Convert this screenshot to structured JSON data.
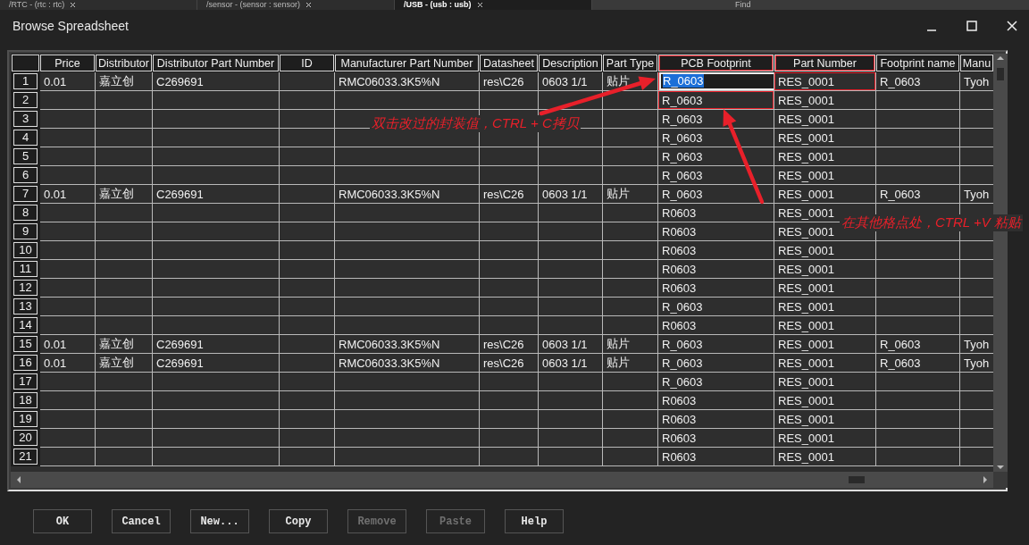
{
  "tabs": [
    {
      "label": "/RTC - (rtc : rtc)",
      "selected": false
    },
    {
      "label": "/sensor - (sensor : sensor)",
      "selected": false
    },
    {
      "label": "/USB - (usb : usb)",
      "selected": true
    },
    {
      "label": "Find",
      "selected": false
    }
  ],
  "window": {
    "title": "Browse Spreadsheet"
  },
  "columns": [
    {
      "label": "Price",
      "marked": false
    },
    {
      "label": "Distributor",
      "marked": false
    },
    {
      "label": "Distributor Part Number",
      "marked": false
    },
    {
      "label": "ID",
      "marked": false
    },
    {
      "label": "Manufacturer Part Number",
      "marked": false
    },
    {
      "label": "Datasheet",
      "marked": false
    },
    {
      "label": "Description",
      "marked": false
    },
    {
      "label": "Part Type",
      "marked": false
    },
    {
      "label": "PCB Footprint",
      "marked": true
    },
    {
      "label": "Part Number",
      "marked": true
    },
    {
      "label": "Footprint name",
      "marked": false
    },
    {
      "label": "Manu",
      "marked": false
    }
  ],
  "rows": [
    {
      "number": "1",
      "editing": true,
      "cells": [
        {
          "text": "0.01",
          "marked": false
        },
        {
          "text": "嘉立创",
          "marked": false
        },
        {
          "text": "C269691",
          "marked": false
        },
        null,
        {
          "text": "RMC06033.3K5%N",
          "marked": false
        },
        {
          "text": "res\\C26",
          "marked": false
        },
        {
          "text": "0603 1/1",
          "marked": false
        },
        {
          "text": "贴片",
          "marked": false
        },
        {
          "text": "R_0603",
          "marked": true
        },
        {
          "text": "RES_0001",
          "marked": true
        },
        {
          "text": "R_0603",
          "marked": false
        },
        {
          "text": "Tyoh",
          "marked": false
        }
      ]
    },
    {
      "number": "2",
      "editing": false,
      "cells": [
        null,
        null,
        null,
        null,
        null,
        null,
        null,
        null,
        {
          "text": "R_0603",
          "marked": true
        },
        {
          "text": "RES_0001",
          "marked": false
        },
        null,
        null
      ]
    },
    {
      "number": "3",
      "editing": false,
      "cells": [
        null,
        null,
        null,
        null,
        null,
        null,
        null,
        null,
        {
          "text": "R_0603",
          "marked": false
        },
        {
          "text": "RES_0001",
          "marked": false
        },
        null,
        null
      ]
    },
    {
      "number": "4",
      "editing": false,
      "cells": [
        null,
        null,
        null,
        null,
        null,
        null,
        null,
        null,
        {
          "text": "R_0603",
          "marked": false
        },
        {
          "text": "RES_0001",
          "marked": false
        },
        null,
        null
      ]
    },
    {
      "number": "5",
      "editing": false,
      "cells": [
        null,
        null,
        null,
        null,
        null,
        null,
        null,
        null,
        {
          "text": "R_0603",
          "marked": false
        },
        {
          "text": "RES_0001",
          "marked": false
        },
        null,
        null
      ]
    },
    {
      "number": "6",
      "editing": false,
      "cells": [
        null,
        null,
        null,
        null,
        null,
        null,
        null,
        null,
        {
          "text": "R_0603",
          "marked": false
        },
        {
          "text": "RES_0001",
          "marked": false
        },
        null,
        null
      ]
    },
    {
      "number": "7",
      "editing": false,
      "cells": [
        {
          "text": "0.01",
          "marked": false
        },
        {
          "text": "嘉立创",
          "marked": false
        },
        {
          "text": "C269691",
          "marked": false
        },
        null,
        {
          "text": "RMC06033.3K5%N",
          "marked": false
        },
        {
          "text": "res\\C26",
          "marked": false
        },
        {
          "text": "0603 1/1",
          "marked": false
        },
        {
          "text": "贴片",
          "marked": false
        },
        {
          "text": "R_0603",
          "marked": false
        },
        {
          "text": "RES_0001",
          "marked": false
        },
        {
          "text": "R_0603",
          "marked": false
        },
        {
          "text": "Tyoh",
          "marked": false
        }
      ]
    },
    {
      "number": "8",
      "editing": false,
      "cells": [
        null,
        null,
        null,
        null,
        null,
        null,
        null,
        null,
        {
          "text": "R0603",
          "marked": false
        },
        {
          "text": "RES_0001",
          "marked": false
        },
        null,
        null
      ]
    },
    {
      "number": "9",
      "editing": false,
      "cells": [
        null,
        null,
        null,
        null,
        null,
        null,
        null,
        null,
        {
          "text": "R0603",
          "marked": false
        },
        {
          "text": "RES_0001",
          "marked": false
        },
        null,
        null
      ]
    },
    {
      "number": "10",
      "editing": false,
      "cells": [
        null,
        null,
        null,
        null,
        null,
        null,
        null,
        null,
        {
          "text": "R0603",
          "marked": false
        },
        {
          "text": "RES_0001",
          "marked": false
        },
        null,
        null
      ]
    },
    {
      "number": "11",
      "editing": false,
      "cells": [
        null,
        null,
        null,
        null,
        null,
        null,
        null,
        null,
        {
          "text": "R0603",
          "marked": false
        },
        {
          "text": "RES_0001",
          "marked": false
        },
        null,
        null
      ]
    },
    {
      "number": "12",
      "editing": false,
      "cells": [
        null,
        null,
        null,
        null,
        null,
        null,
        null,
        null,
        {
          "text": "R0603",
          "marked": false
        },
        {
          "text": "RES_0001",
          "marked": false
        },
        null,
        null
      ]
    },
    {
      "number": "13",
      "editing": false,
      "cells": [
        null,
        null,
        null,
        null,
        null,
        null,
        null,
        null,
        {
          "text": "R_0603",
          "marked": false
        },
        {
          "text": "RES_0001",
          "marked": false
        },
        null,
        null
      ]
    },
    {
      "number": "14",
      "editing": false,
      "cells": [
        null,
        null,
        null,
        null,
        null,
        null,
        null,
        null,
        {
          "text": "R0603",
          "marked": false
        },
        {
          "text": "RES_0001",
          "marked": false
        },
        null,
        null
      ]
    },
    {
      "number": "15",
      "editing": false,
      "cells": [
        {
          "text": "0.01",
          "marked": false
        },
        {
          "text": "嘉立创",
          "marked": false
        },
        {
          "text": "C269691",
          "marked": false
        },
        null,
        {
          "text": "RMC06033.3K5%N",
          "marked": false
        },
        {
          "text": "res\\C26",
          "marked": false
        },
        {
          "text": "0603 1/1",
          "marked": false
        },
        {
          "text": "贴片",
          "marked": false
        },
        {
          "text": "R_0603",
          "marked": false
        },
        {
          "text": "RES_0001",
          "marked": false
        },
        {
          "text": "R_0603",
          "marked": false
        },
        {
          "text": "Tyoh",
          "marked": false
        }
      ]
    },
    {
      "number": "16",
      "editing": false,
      "cells": [
        {
          "text": "0.01",
          "marked": false
        },
        {
          "text": "嘉立创",
          "marked": false
        },
        {
          "text": "C269691",
          "marked": false
        },
        null,
        {
          "text": "RMC06033.3K5%N",
          "marked": false
        },
        {
          "text": "res\\C26",
          "marked": false
        },
        {
          "text": "0603 1/1",
          "marked": false
        },
        {
          "text": "贴片",
          "marked": false
        },
        {
          "text": "R_0603",
          "marked": false
        },
        {
          "text": "RES_0001",
          "marked": false
        },
        {
          "text": "R_0603",
          "marked": false
        },
        {
          "text": "Tyoh",
          "marked": false
        }
      ]
    },
    {
      "number": "17",
      "editing": false,
      "cells": [
        null,
        null,
        null,
        null,
        null,
        null,
        null,
        null,
        {
          "text": "R_0603",
          "marked": false
        },
        {
          "text": "RES_0001",
          "marked": false
        },
        null,
        null
      ]
    },
    {
      "number": "18",
      "editing": false,
      "cells": [
        null,
        null,
        null,
        null,
        null,
        null,
        null,
        null,
        {
          "text": "R0603",
          "marked": false
        },
        {
          "text": "RES_0001",
          "marked": false
        },
        null,
        null
      ]
    },
    {
      "number": "19",
      "editing": false,
      "cells": [
        null,
        null,
        null,
        null,
        null,
        null,
        null,
        null,
        {
          "text": "R0603",
          "marked": false
        },
        {
          "text": "RES_0001",
          "marked": false
        },
        null,
        null
      ]
    },
    {
      "number": "20",
      "editing": false,
      "cells": [
        null,
        null,
        null,
        null,
        null,
        null,
        null,
        null,
        {
          "text": "R0603",
          "marked": false
        },
        {
          "text": "RES_0001",
          "marked": false
        },
        null,
        null
      ]
    },
    {
      "number": "21",
      "editing": false,
      "cells": [
        null,
        null,
        null,
        null,
        null,
        null,
        null,
        null,
        {
          "text": "R0603",
          "marked": false
        },
        {
          "text": "RES_0001",
          "marked": false
        },
        null,
        null
      ]
    }
  ],
  "buttons": [
    {
      "label": "OK",
      "disabled": false
    },
    {
      "label": "Cancel",
      "disabled": false
    },
    {
      "label": "New...",
      "disabled": false
    },
    {
      "label": "Copy",
      "disabled": false
    },
    {
      "label": "Remove",
      "disabled": true
    },
    {
      "label": "Paste",
      "disabled": true
    },
    {
      "label": "Help",
      "disabled": false
    }
  ],
  "annotations": [
    {
      "text": "双击改过的封装值，CTRL + C拷贝"
    },
    {
      "text": "在其他格点处，CTRL +V 粘贴"
    }
  ]
}
